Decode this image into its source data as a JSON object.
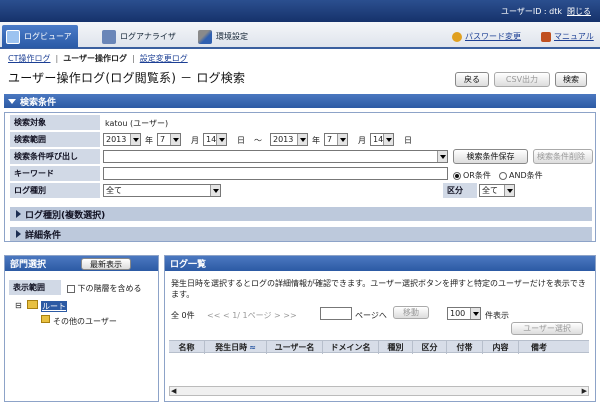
{
  "header": {
    "user_id": "ユーザーID : dtk",
    "close": "閉じる"
  },
  "nav": {
    "tabs": [
      {
        "label": "ログビューア",
        "icon": "log-viewer-icon",
        "active": true
      },
      {
        "label": "ログアナライザ",
        "icon": "log-analyzer-icon",
        "active": false
      },
      {
        "label": "環境設定",
        "icon": "settings-tools-icon",
        "active": false
      }
    ],
    "password_change": "パスワード変更",
    "manual": "マニュアル"
  },
  "breadcrumb": {
    "item1": "CT操作ログ",
    "item2": "ユーザー操作ログ",
    "item3": "設定変更ログ"
  },
  "page": {
    "title": "ユーザー操作ログ(ログ閲覧系) － ログ検索"
  },
  "toolbar": {
    "back": "戻る",
    "csv": "CSV出力",
    "search": "検索"
  },
  "search": {
    "header": "検索条件",
    "target_label": "検索対象",
    "target_value": "katou (ユーザー)",
    "range_label": "検索範囲",
    "from": {
      "year": "2013",
      "month": "7",
      "day": "14"
    },
    "to": {
      "year": "2013",
      "month": "7",
      "day": "14"
    },
    "year_unit": "年",
    "month_unit": "月",
    "day_unit": "日",
    "tilde": "～",
    "recall_label": "検索条件呼び出し",
    "save_button": "検索条件保存",
    "delete_button": "検索条件削除",
    "keyword_label": "キーワード",
    "or_label": "OR条件",
    "and_label": "AND条件",
    "logtype_label": "ログ種別",
    "logtype_value": "全て",
    "kubun_label": "区分",
    "kubun_value": "全て",
    "multi_logtype": "ログ種別(複数選択)",
    "detail": "詳細条件"
  },
  "dept": {
    "header": "部門選択",
    "latest_button": "最新表示",
    "range_label": "表示範囲",
    "include_lower": "下の階層を含める",
    "root": "ルート",
    "other_users": "その他のユーザー"
  },
  "loglist": {
    "header": "ログ一覧",
    "description": "発生日時を選択するとログの詳細情報が確認できます。ユーザー選択ボタンを押すと特定のユーザーだけを表示できます。",
    "count": "全 0件",
    "pager": "<< < 1/ 1ページ > >>",
    "page_to": "ページへ",
    "move_button": "移動",
    "per_page": "100",
    "per_page_unit": "件表示",
    "user_select_button": "ユーザー選択",
    "columns": [
      "名称",
      "発生日時",
      "ユーザー名",
      "ドメイン名",
      "種別",
      "区分",
      "付帯",
      "内容",
      "備考"
    ]
  },
  "colors": {
    "header_blue": "#16326b",
    "section_blue": "#2c5aa4",
    "label_bg": "#d1d9e6"
  }
}
